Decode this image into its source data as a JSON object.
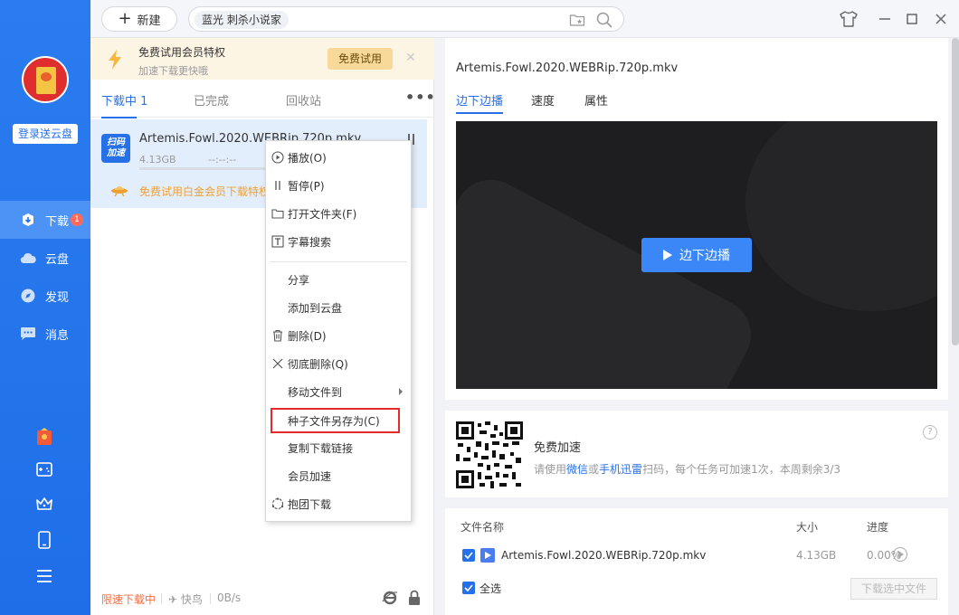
{
  "sidebar": {
    "login_label": "登录送云盘",
    "nav": [
      {
        "label": "下载",
        "badge": "1"
      },
      {
        "label": "云盘"
      },
      {
        "label": "发现"
      },
      {
        "label": "消息"
      }
    ],
    "bottom_icons": [
      "red-packet-icon",
      "gamepad-icon",
      "crown-icon",
      "phone-icon",
      "menu-icon"
    ],
    "accent": "#2670e8"
  },
  "topbar": {
    "new_label": "新建",
    "search_tag": "蓝光  刺杀小说家"
  },
  "list": {
    "promo_title": "免费试用会员特权",
    "promo_sub": "加速下载更快哦",
    "promo_button": "免费试用",
    "tabs": [
      {
        "label": "下载中",
        "count": "1"
      },
      {
        "label": "已完成"
      },
      {
        "label": "回收站"
      }
    ],
    "more": "•••",
    "item": {
      "icon_text_1": "扫码",
      "icon_text_2": "加速",
      "name": "Artemis.Fowl.2020.WEBRip.720p.mkv",
      "size": "4.13GB",
      "eta": "--:--:--",
      "promo": "免费试用白金会员下载特权"
    },
    "status": {
      "limit": "限速下载中",
      "mode": "快鸟",
      "speed": "0B/s"
    }
  },
  "context_menu": [
    {
      "label": "播放(O)",
      "icon": "play-circle-icon"
    },
    {
      "label": "暂停(P)",
      "icon": "pause-icon"
    },
    {
      "label": "打开文件夹(F)",
      "icon": "folder-icon"
    },
    {
      "label": "字幕搜索",
      "icon": "subtitle-icon"
    },
    {
      "label": "分享",
      "icon": ""
    },
    {
      "label": "添加到云盘",
      "icon": ""
    },
    {
      "label": "删除(D)",
      "icon": "trash-icon"
    },
    {
      "label": "彻底删除(Q)",
      "icon": "close-icon"
    },
    {
      "label": "移动文件到",
      "icon": "",
      "submenu": true
    },
    {
      "label": "种子文件另存为(C)",
      "icon": "",
      "highlight": true
    },
    {
      "label": "复制下载链接",
      "icon": ""
    },
    {
      "label": "会员加速",
      "icon": ""
    },
    {
      "label": "抱团下载",
      "icon": "group-icon"
    }
  ],
  "detail": {
    "title": "Artemis.Fowl.2020.WEBRip.720p.mkv",
    "tabs": [
      "边下边播",
      "速度",
      "属性"
    ],
    "play_button": "边下边播",
    "speedup_title": "免费加速",
    "speedup_desc_1": "请使用",
    "speedup_link_1": "微信",
    "speedup_desc_2": "或",
    "speedup_link_2": "手机迅雷",
    "speedup_desc_3": "扫码，每个任务可加速1次，本周剩余3/3",
    "help": "?",
    "table": {
      "headers": [
        "文件名称",
        "大小",
        "进度"
      ],
      "rows": [
        {
          "name": "Artemis.Fowl.2020.WEBRip.720p.mkv",
          "size": "4.13GB",
          "progress": "0.00%"
        }
      ],
      "select_all": "全选",
      "download_selected": "下载选中文件"
    }
  }
}
